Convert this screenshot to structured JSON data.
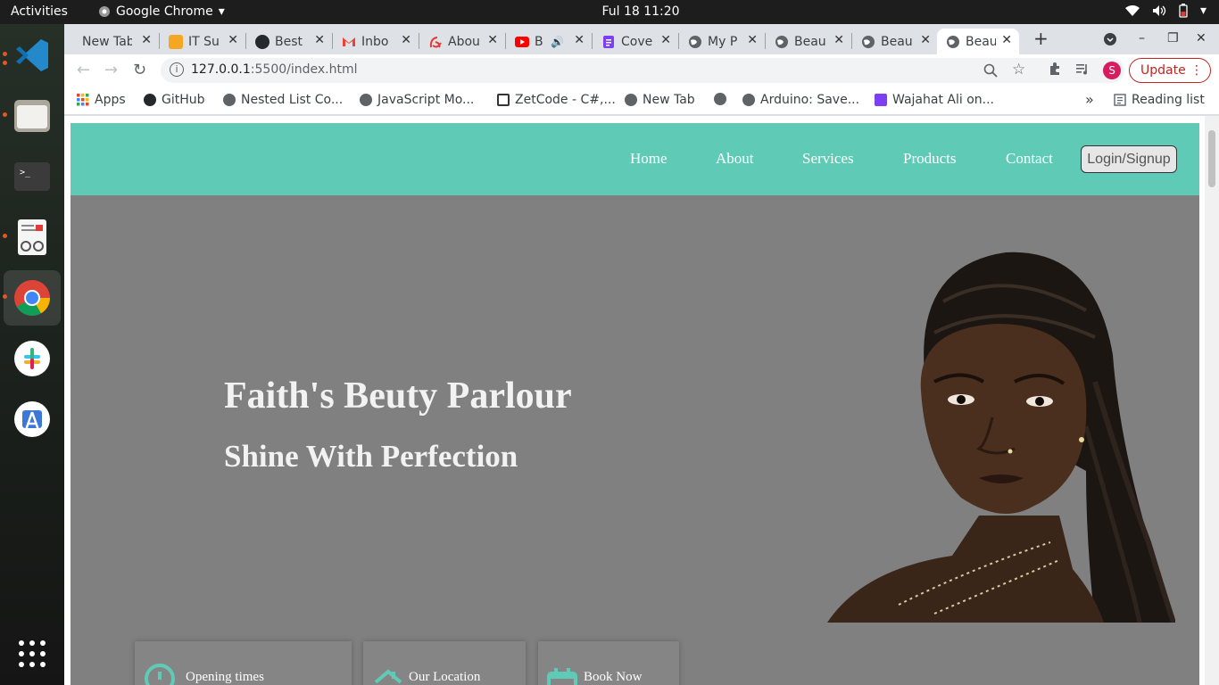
{
  "os": {
    "activities": "Activities",
    "app_name": "Google Chrome",
    "clock": "Ful 18  11:20"
  },
  "browser": {
    "tabs": [
      {
        "title": "New Tab",
        "fav_color": "#dadce0"
      },
      {
        "title": "IT Su",
        "fav_color": "#f5a623"
      },
      {
        "title": "Best",
        "fav_color": "#24292e"
      },
      {
        "title": "Inbo",
        "fav_color": "#ea4335"
      },
      {
        "title": "Abou",
        "fav_color": "#e53935"
      },
      {
        "title": "B",
        "fav_color": "#ff0000"
      },
      {
        "title": "Cove",
        "fav_color": "#7e3ff2"
      },
      {
        "title": "My P",
        "fav_color": "#5f6368"
      },
      {
        "title": "Beau",
        "fav_color": "#5f6368"
      },
      {
        "title": "Beau",
        "fav_color": "#5f6368"
      },
      {
        "title": "Beau",
        "fav_color": "#5f6368"
      }
    ],
    "url_host": "127.0.0.1",
    "url_rest": ":5500/index.html",
    "update_label": "Update",
    "profile_initial": "S",
    "bookmarks": [
      {
        "label": "Apps"
      },
      {
        "label": "GitHub"
      },
      {
        "label": "Nested List Co..."
      },
      {
        "label": "JavaScript Mo..."
      },
      {
        "label": "ZetCode - C#,..."
      },
      {
        "label": "New Tab"
      },
      {
        "label": ""
      },
      {
        "label": "Arduino: Save..."
      },
      {
        "label": "Wajahat Ali on..."
      }
    ],
    "overflow_label": "»",
    "reading_list": "Reading list"
  },
  "site": {
    "nav": [
      "Home",
      "About",
      "Services",
      "Products",
      "Contact"
    ],
    "login_label": "Login/Signup",
    "hero_title": "Faith's Beuty Parlour",
    "hero_subtitle": "Shine With Perfection",
    "cards": [
      {
        "label": "Opening times",
        "icon": "clock-icon"
      },
      {
        "label": "Our Location",
        "icon": "home-icon"
      },
      {
        "label": "Book Now",
        "icon": "calendar-icon"
      }
    ],
    "accent": "#5fcbb6",
    "hero_bg": "#808080"
  }
}
